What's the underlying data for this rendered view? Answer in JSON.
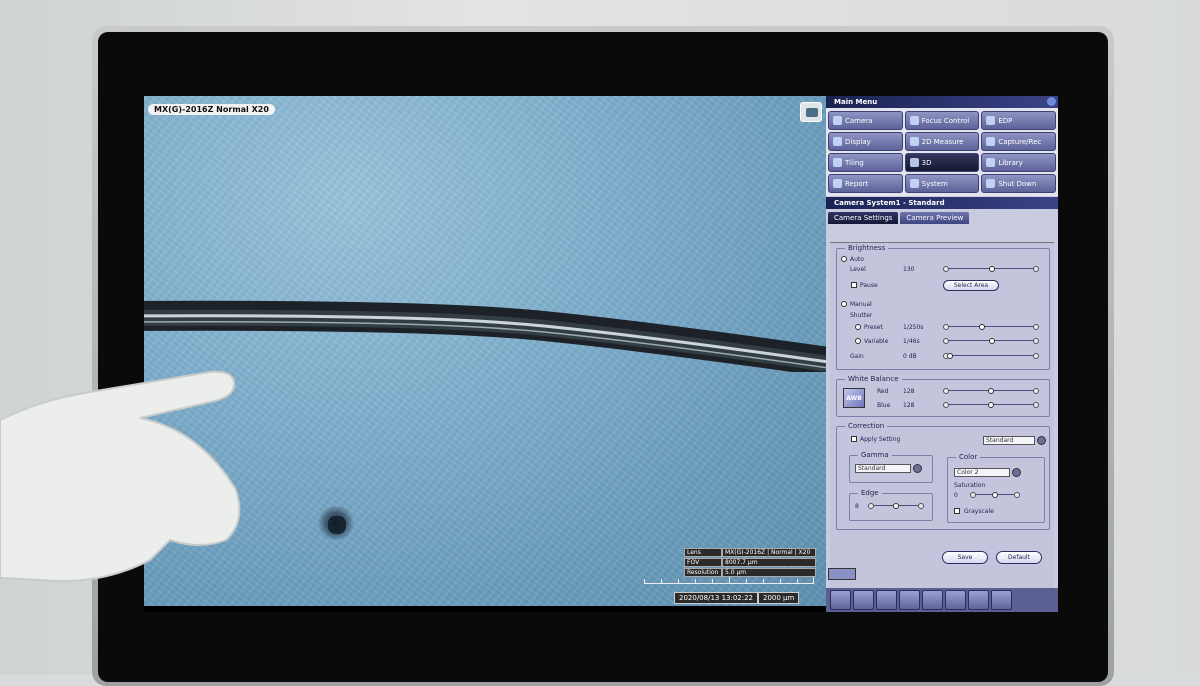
{
  "overlay": {
    "lens_label": "MX(G)-2016Z Normal X20",
    "info": {
      "lens_key": "Lens",
      "lens_val": "MX(G)-2016Z | Normal | X20",
      "fov_key": "FOV",
      "fov_val": "8007.7 µm",
      "res_key": "Resolution",
      "res_val": "5.0 µm"
    },
    "datetime": "2020/08/13 13:02:22",
    "scale": "2000 µm"
  },
  "main_menu": {
    "title": "Main Menu",
    "buttons": [
      {
        "label": "Camera",
        "icon": "camera-icon",
        "active": false
      },
      {
        "label": "Focus Control",
        "icon": "focus-icon",
        "active": false
      },
      {
        "label": "EDP",
        "icon": "edp-icon",
        "active": false
      },
      {
        "label": "Display",
        "icon": "display-icon",
        "active": false
      },
      {
        "label": "2D Measure",
        "icon": "measure-icon",
        "active": false
      },
      {
        "label": "Capture/Rec",
        "icon": "capture-icon",
        "active": false
      },
      {
        "label": "Tiling",
        "icon": "tiling-icon",
        "active": false
      },
      {
        "label": "3D",
        "icon": "cube-icon",
        "active": true
      },
      {
        "label": "Library",
        "icon": "library-icon",
        "active": false
      },
      {
        "label": "Report",
        "icon": "report-icon",
        "active": false
      },
      {
        "label": "System",
        "icon": "system-icon",
        "active": false
      },
      {
        "label": "Shut Down",
        "icon": "power-icon",
        "active": false
      }
    ]
  },
  "camera_system": {
    "title": "Camera System1 - Standard",
    "tabs": [
      "Camera Settings",
      "Camera Preview"
    ]
  },
  "brightness": {
    "title": "Brightness",
    "auto": "Auto",
    "level_label": "Level",
    "level_value": "130",
    "pause": "Pause",
    "select_area": "Select Area",
    "manual": "Manual",
    "shutter": "Shutter",
    "preset": "Preset",
    "preset_value": "1/250s",
    "variable": "Variable",
    "variable_value": "1/46s",
    "gain": "Gain",
    "gain_value": "0 dB"
  },
  "white_balance": {
    "title": "White Balance",
    "awb": "AWB",
    "red": "Red",
    "red_value": "128",
    "blue": "Blue",
    "blue_value": "128"
  },
  "correction": {
    "title": "Correction",
    "apply_setting": "Apply Setting",
    "apply_select": "Standard",
    "gamma": "Gamma",
    "gamma_select": "Standard",
    "color": "Color",
    "color_select": "Color 2",
    "saturation": "Saturation",
    "saturation_value": "0",
    "edge": "Edge",
    "edge_value": "8",
    "grayscale": "Grayscale"
  },
  "actions": {
    "save": "Save",
    "default": "Default"
  }
}
